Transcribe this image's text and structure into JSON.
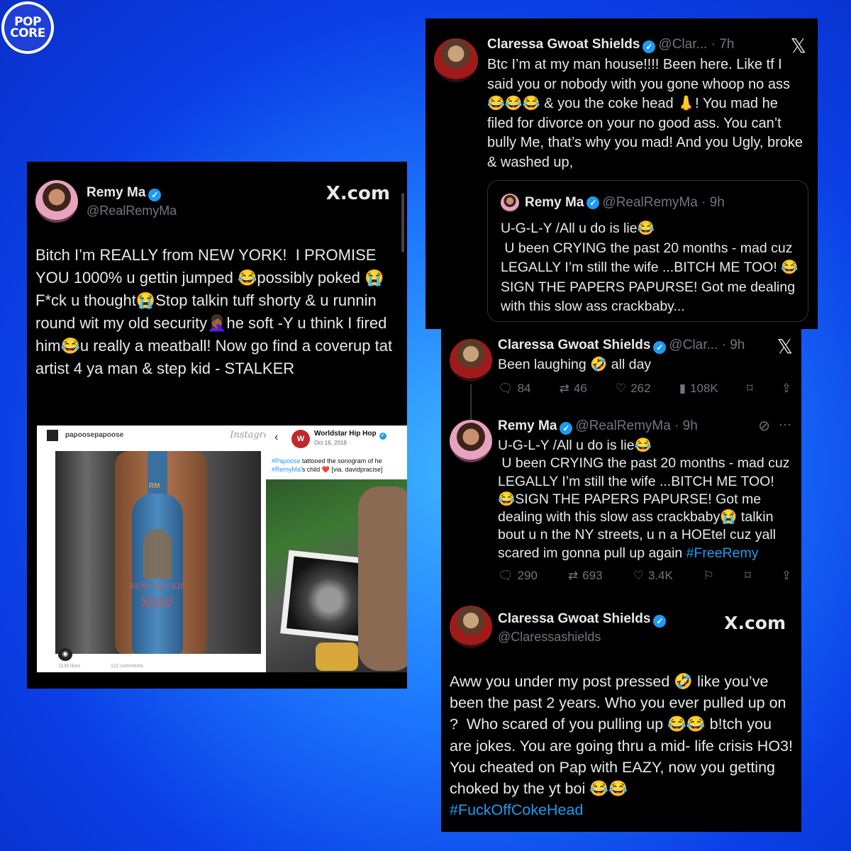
{
  "logo": {
    "line1": "POP",
    "line2": "CORE"
  },
  "remy_card": {
    "name": "Remy Ma",
    "handle": "@RealRemyMa",
    "site": "X.com",
    "text": "Bitch I’m REALLY from NEW YORK!  I PROMISE YOU 1000% u gettin jumped 😂possibly poked 😭F*ck u thought😭Stop talkin tuff shorty & u runnin round wit my old security🤦🏾‍♀️he soft -Y u think I fired him😂u really a meatball! Now go find a coverup tat artist 4 ya man & step kid - STALKER",
    "instagram": {
      "username": "papoosepapoose",
      "brand": "Instagram",
      "tattoo_text": "REMY MACKIE",
      "tattoo_num": "XXIV",
      "tattoo_rm": "RM",
      "likes": "1139 likes",
      "comments": "122 comments"
    },
    "worldstar": {
      "name": "Worldstar Hip Hop",
      "date": "Oct 16, 2018 · ",
      "caption_tag1": "#Papoose",
      "caption_mid": " tattooed the sonogram of he",
      "caption_tag2": "#RemyMa",
      "caption_end": "'s child ❤️ [via. davidpracise]"
    }
  },
  "claressa_top": {
    "name": "Claressa Gwoat Shields",
    "handle": "@Clar... · 7h",
    "text": "Btc I’m at my man house!!!! Been here. Like tf I said you or nobody with you gone whoop no ass 😂😂😂 & you the coke head 👃! You mad he filed for divorce on your no good ass. You can’t bully Me, that’s why you mad! And you Ugly, broke & washed up,",
    "quote": {
      "name": "Remy Ma",
      "handle": "@RealRemyMa · 9h",
      "text": "U-G-L-Y /All u do is lie😂\n U been CRYING the past 20 months - mad cuz LEGALLY I’m still the wife ...BITCH ME TOO! 😂SIGN THE PAPERS PAPURSE! Got me dealing with this slow ass crackbaby..."
    }
  },
  "thread": {
    "tweet1": {
      "name": "Claressa Gwoat Shields",
      "handle": "@Clar... · 9h",
      "text": "Been laughing 🤣 all day",
      "replies": "84",
      "reposts": "46",
      "likes": "262",
      "views": "108K"
    },
    "tweet2": {
      "name": "Remy Ma",
      "handle": "@RealRemyMa · 9h",
      "text": "U-G-L-Y /All u do is lie😂\n U been CRYING the past 20 months - mad cuz LEGALLY I’m still the wife ...BITCH ME TOO! 😂SIGN THE PAPERS PAPURSE! Got me dealing with this slow ass crackbaby😭 talkin bout u n the NY streets, u n a HOEtel cuz yall scared im gonna pull up again ",
      "hashtag": "#FreeRemy",
      "replies": "290",
      "reposts": "693",
      "likes": "3.4K"
    },
    "tweet3": {
      "name": "Claressa Gwoat Shields",
      "handle": "@Claressashields",
      "site": "X.com",
      "text": "Aww you under my post pressed 🤣 like you’ve been the past 2 years. Who you ever pulled up on ?  Who scared of you pulling up 😂😂 b!tch you are jokes. You are going thru a mid- life crisis HO3! You cheated on Pap with EAZY, now you getting choked by the yt boi 😂😂",
      "hashtag": "#FuckOffCokeHead"
    }
  },
  "colors": {
    "accent": "#1d9bf0",
    "card_bg": "#000000",
    "muted": "#71767b"
  }
}
